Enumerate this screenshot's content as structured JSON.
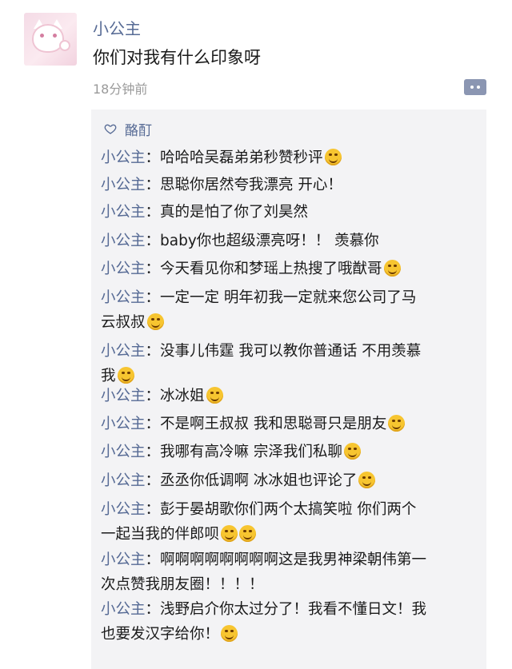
{
  "post": {
    "username": "小公主",
    "text": "你们对我有什么印象呀",
    "time": "18分钟前"
  },
  "likes": {
    "names": "酪酊"
  },
  "comments": [
    {
      "name": "小公主",
      "lines": [
        "：哈哈哈吴磊弟弟秒赞秒评"
      ],
      "emojis": [
        "smirk-emoji"
      ]
    },
    {
      "name": "小公主",
      "lines": [
        "：思聪你居然夸我漂亮 开心！"
      ],
      "emojis": []
    },
    {
      "name": "小公主",
      "lines": [
        "：真的是怕了你了刘昊然"
      ],
      "emojis": []
    },
    {
      "name": "小公主",
      "lines": [
        "：baby你也超级漂亮呀！！ 羡慕你"
      ],
      "emojis": []
    },
    {
      "name": "小公主",
      "lines": [
        "：今天看见你和梦瑶上热搜了哦猷哥"
      ],
      "emojis": [
        "smirk-emoji"
      ]
    },
    {
      "name": "小公主",
      "lines": [
        "：一定一定 明年初我一定就来您公司了马",
        "云叔叔"
      ],
      "emojis": [
        "grin-emoji"
      ]
    },
    {
      "name": "小公主",
      "lines": [
        "：没事儿伟霆 我可以教你普通话 不用羡慕",
        "我"
      ],
      "emojis": [
        "laugh-emoji"
      ]
    },
    {
      "name": "小公主",
      "lines": [
        "：冰冰姐"
      ],
      "emojis": [
        "tears-emoji"
      ]
    },
    {
      "name": "小公主",
      "lines": [
        "：不是啊王叔叔 我和思聪哥只是朋友"
      ],
      "emojis": [
        "laugh-emoji"
      ]
    },
    {
      "name": "小公主",
      "lines": [
        "：我哪有高冷嘛 宗泽我们私聊"
      ],
      "emojis": [
        "shy-emoji"
      ]
    },
    {
      "name": "小公主",
      "lines": [
        "：丞丞你低调啊 冰冰姐也评论了"
      ],
      "emojis": [
        "tears-emoji"
      ]
    },
    {
      "name": "小公主",
      "lines": [
        "：彭于晏胡歌你们两个太搞笑啦 你们两个",
        "一起当我的伴郎呗"
      ],
      "emojis": [
        "laugh-emoji",
        "laugh-emoji"
      ]
    },
    {
      "name": "小公主",
      "lines": [
        "：啊啊啊啊啊啊啊啊这是我男神梁朝伟第一",
        "次点赞我朋友圈！！！！"
      ],
      "emojis": []
    },
    {
      "name": "小公主",
      "lines": [
        "：浅野启介你太过分了！我看不懂日文！我",
        "也要发汉字给你！"
      ],
      "emojis": [
        "laugh-emoji"
      ]
    }
  ],
  "colors": {
    "link": "#576b95",
    "text": "#1a1a1a",
    "meta": "#9a9a9a",
    "panel": "#f3f3f5"
  }
}
